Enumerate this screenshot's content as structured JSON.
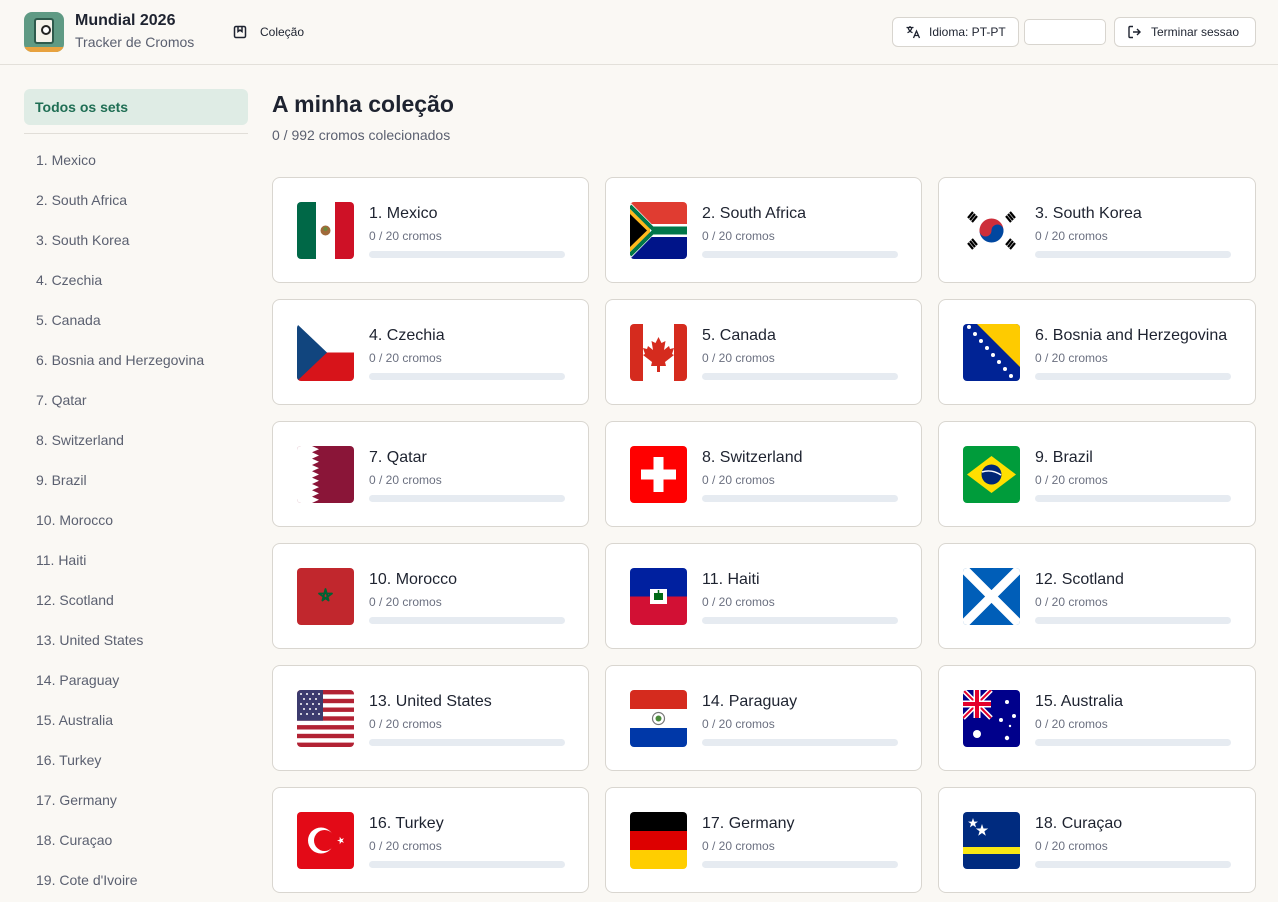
{
  "header": {
    "app_title": "Mundial 2026",
    "app_subtitle": "Tracker de Cromos",
    "nav_collection": "Coleção",
    "language_button": "Idioma: PT-PT",
    "logout_button": "Terminar sessao"
  },
  "sidebar": {
    "all_sets": "Todos os sets",
    "items": [
      "1. Mexico",
      "2. South Africa",
      "3. South Korea",
      "4. Czechia",
      "5. Canada",
      "6. Bosnia and Herzegovina",
      "7. Qatar",
      "8. Switzerland",
      "9. Brazil",
      "10. Morocco",
      "11. Haiti",
      "12. Scotland",
      "13. United States",
      "14. Paraguay",
      "15. Australia",
      "16. Turkey",
      "17. Germany",
      "18. Curaçao",
      "19. Cote d'Ivoire"
    ]
  },
  "main": {
    "title": "A minha coleção",
    "subtitle": "0 / 992 cromos colecionados"
  },
  "sets": [
    {
      "name": "1. Mexico",
      "count": "0 / 20 cromos",
      "progress": 0,
      "flag": "mexico-flag-icon"
    },
    {
      "name": "2. South Africa",
      "count": "0 / 20 cromos",
      "progress": 0,
      "flag": "south-africa-flag-icon"
    },
    {
      "name": "3. South Korea",
      "count": "0 / 20 cromos",
      "progress": 0,
      "flag": "south-korea-flag-icon"
    },
    {
      "name": "4. Czechia",
      "count": "0 / 20 cromos",
      "progress": 0,
      "flag": "czechia-flag-icon"
    },
    {
      "name": "5. Canada",
      "count": "0 / 20 cromos",
      "progress": 0,
      "flag": "canada-flag-icon"
    },
    {
      "name": "6. Bosnia and Herzegovina",
      "count": "0 / 20 cromos",
      "progress": 0,
      "flag": "bosnia-flag-icon"
    },
    {
      "name": "7. Qatar",
      "count": "0 / 20 cromos",
      "progress": 0,
      "flag": "qatar-flag-icon"
    },
    {
      "name": "8. Switzerland",
      "count": "0 / 20 cromos",
      "progress": 0,
      "flag": "switzerland-flag-icon"
    },
    {
      "name": "9. Brazil",
      "count": "0 / 20 cromos",
      "progress": 0,
      "flag": "brazil-flag-icon"
    },
    {
      "name": "10. Morocco",
      "count": "0 / 20 cromos",
      "progress": 0,
      "flag": "morocco-flag-icon"
    },
    {
      "name": "11. Haiti",
      "count": "0 / 20 cromos",
      "progress": 0,
      "flag": "haiti-flag-icon"
    },
    {
      "name": "12. Scotland",
      "count": "0 / 20 cromos",
      "progress": 0,
      "flag": "scotland-flag-icon"
    },
    {
      "name": "13. United States",
      "count": "0 / 20 cromos",
      "progress": 0,
      "flag": "usa-flag-icon"
    },
    {
      "name": "14. Paraguay",
      "count": "0 / 20 cromos",
      "progress": 0,
      "flag": "paraguay-flag-icon"
    },
    {
      "name": "15. Australia",
      "count": "0 / 20 cromos",
      "progress": 0,
      "flag": "australia-flag-icon"
    },
    {
      "name": "16. Turkey",
      "count": "0 / 20 cromos",
      "progress": 0,
      "flag": "turkey-flag-icon"
    },
    {
      "name": "17. Germany",
      "count": "0 / 20 cromos",
      "progress": 0,
      "flag": "germany-flag-icon"
    },
    {
      "name": "18. Curaçao",
      "count": "0 / 20 cromos",
      "progress": 0,
      "flag": "curacao-flag-icon"
    }
  ],
  "colors": {
    "accent": "#1f6e54",
    "accent_bg": "#dfece5",
    "progress_track": "#e6ebf1",
    "page_bg": "#faf8f4"
  }
}
